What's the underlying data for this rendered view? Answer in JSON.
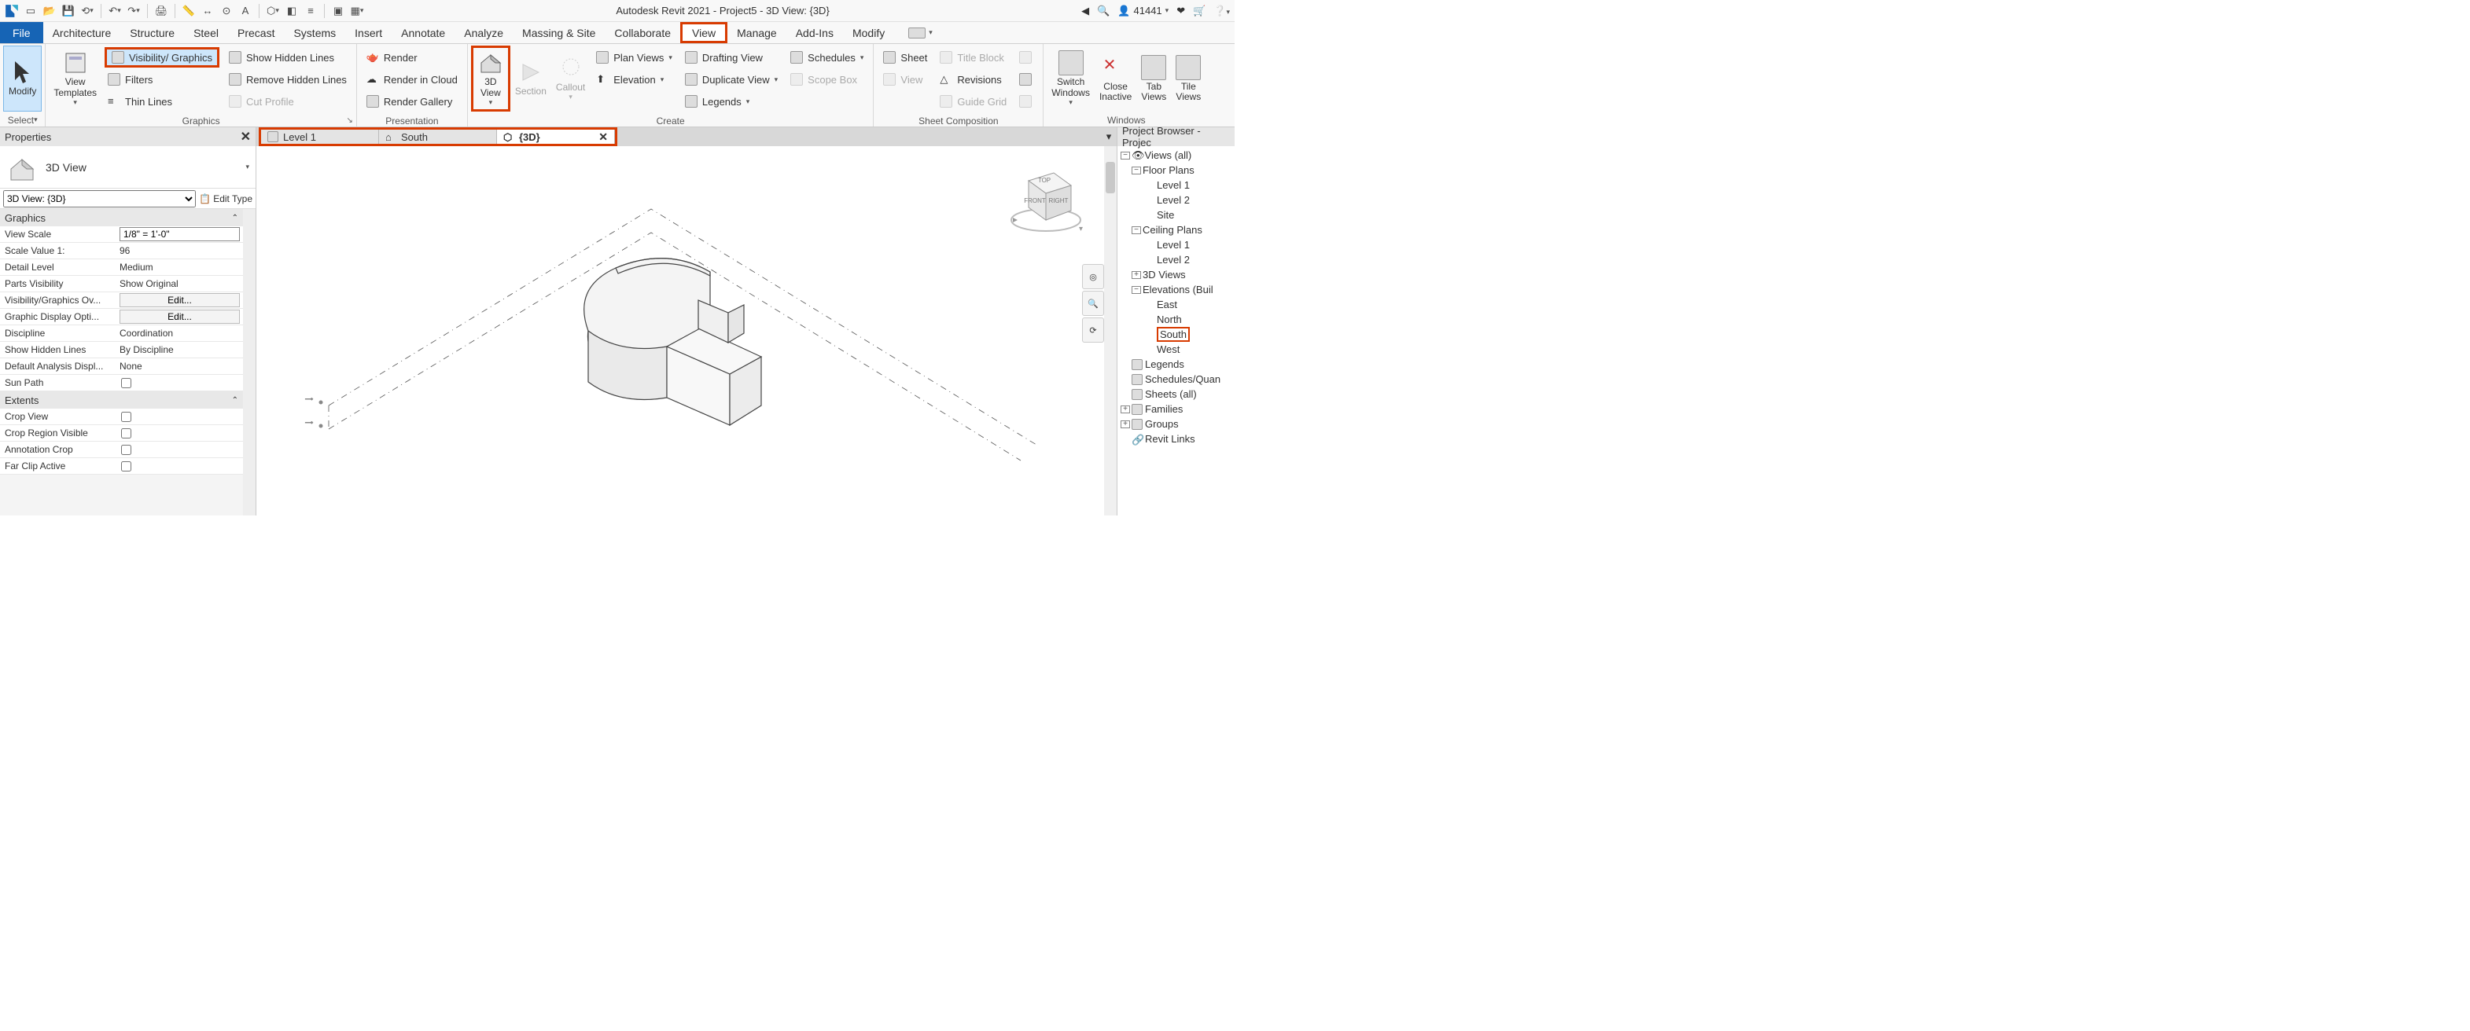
{
  "titlebar": {
    "title": "Autodesk Revit 2021 - Project5 - 3D View: {3D}",
    "user": "41441"
  },
  "menu": {
    "file": "File",
    "tabs": [
      "Architecture",
      "Structure",
      "Steel",
      "Precast",
      "Systems",
      "Insert",
      "Annotate",
      "Analyze",
      "Massing & Site",
      "Collaborate",
      "View",
      "Manage",
      "Add-Ins",
      "Modify"
    ],
    "active": "View"
  },
  "ribbon": {
    "select": {
      "modify": "Modify",
      "label": "Select"
    },
    "graphics": {
      "view_templates": "View\nTemplates",
      "visibility_graphics": "Visibility/ Graphics",
      "filters": "Filters",
      "thin_lines": "Thin  Lines",
      "show_hidden": "Show  Hidden Lines",
      "remove_hidden": "Remove  Hidden Lines",
      "cut_profile": "Cut  Profile",
      "label": "Graphics"
    },
    "presentation": {
      "render": "Render",
      "render_cloud": "Render  in Cloud",
      "render_gallery": "Render  Gallery",
      "label": "Presentation"
    },
    "create": {
      "view3d": "3D\nView",
      "section": "Section",
      "callout": "Callout",
      "plan_views": "Plan  Views",
      "elevation": "Elevation",
      "drafting_view": "Drafting  View",
      "duplicate_view": "Duplicate  View",
      "legends": "Legends",
      "schedules": "Schedules",
      "scope_box": "Scope  Box",
      "label": "Create"
    },
    "sheet_comp": {
      "sheet": "Sheet",
      "view": "View",
      "title_block": "Title  Block",
      "revisions": "Revisions",
      "guide_grid": "Guide  Grid",
      "label": "Sheet Composition"
    },
    "windows": {
      "switch": "Switch\nWindows",
      "close_inactive": "Close\nInactive",
      "tab_views": "Tab\nViews",
      "tile_views": "Tile\nViews",
      "label": "Windows"
    }
  },
  "properties": {
    "panel_title": "Properties",
    "type_name": "3D View",
    "instance": "3D View: {3D}",
    "edit_type": "Edit Type",
    "sections": {
      "graphics": {
        "label": "Graphics",
        "rows": {
          "view_scale": {
            "l": "View Scale",
            "v": "1/8\" = 1'-0\""
          },
          "scale_value": {
            "l": "Scale Value    1:",
            "v": "96"
          },
          "detail_level": {
            "l": "Detail Level",
            "v": "Medium"
          },
          "parts_vis": {
            "l": "Parts Visibility",
            "v": "Show Original"
          },
          "vis_graphics": {
            "l": "Visibility/Graphics Ov...",
            "v": "Edit..."
          },
          "graphic_display": {
            "l": "Graphic Display Opti...",
            "v": "Edit..."
          },
          "discipline": {
            "l": "Discipline",
            "v": "Coordination"
          },
          "show_hidden": {
            "l": "Show Hidden Lines",
            "v": "By Discipline"
          },
          "default_analysis": {
            "l": "Default Analysis Displ...",
            "v": "None"
          },
          "sun_path": {
            "l": "Sun Path",
            "v": false
          }
        }
      },
      "extents": {
        "label": "Extents",
        "rows": {
          "crop_view": {
            "l": "Crop View",
            "v": false
          },
          "crop_region": {
            "l": "Crop Region Visible",
            "v": false
          },
          "annotation_crop": {
            "l": "Annotation Crop",
            "v": false
          },
          "far_clip": {
            "l": "Far Clip Active",
            "v": false
          }
        }
      }
    }
  },
  "view_tabs": {
    "tabs": [
      {
        "label": "Level 1",
        "icon": "floorplan"
      },
      {
        "label": "South",
        "icon": "elevation"
      },
      {
        "label": "{3D}",
        "icon": "3d",
        "active": true
      }
    ]
  },
  "browser": {
    "title": "Project Browser - Projec",
    "root": "Views (all)",
    "floor_plans": {
      "label": "Floor Plans",
      "items": [
        "Level 1",
        "Level 2",
        "Site"
      ]
    },
    "ceiling_plans": {
      "label": "Ceiling Plans",
      "items": [
        "Level 1",
        "Level 2"
      ]
    },
    "views3d": {
      "label": "3D Views"
    },
    "elevations": {
      "label": "Elevations (Buil",
      "items": [
        "East",
        "North",
        "South",
        "West"
      ]
    },
    "legends": "Legends",
    "schedules": "Schedules/Quan",
    "sheets": "Sheets (all)",
    "families": "Families",
    "groups": "Groups",
    "revit_links": "Revit Links"
  }
}
